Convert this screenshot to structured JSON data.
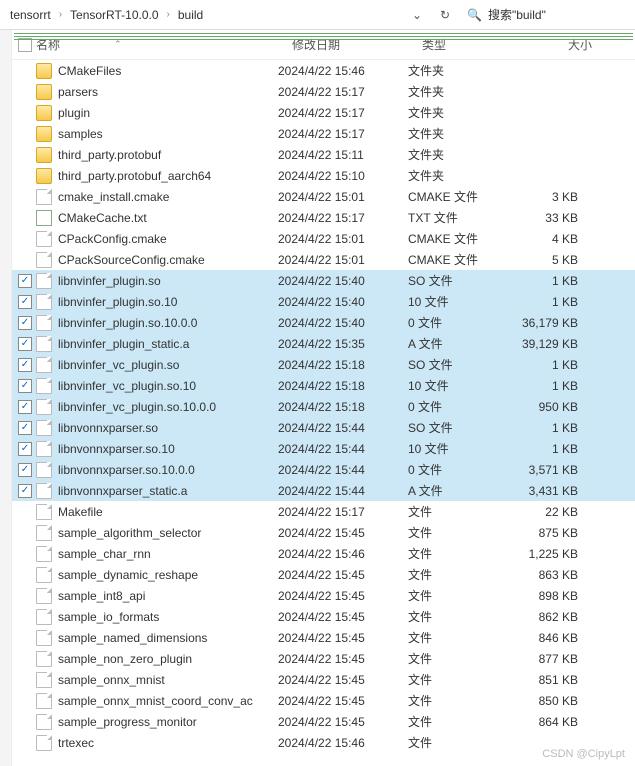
{
  "breadcrumb": {
    "a": "tensorrt",
    "b": "TensorRT-10.0.0",
    "c": "build"
  },
  "search": {
    "label": "搜索\"build\""
  },
  "columns": {
    "name": "名称",
    "date": "修改日期",
    "type": "类型",
    "size": "大小"
  },
  "rows": [
    {
      "sel": false,
      "icon": "folder",
      "name": "CMakeFiles",
      "date": "2024/4/22 15:46",
      "type": "文件夹",
      "size": ""
    },
    {
      "sel": false,
      "icon": "folder",
      "name": "parsers",
      "date": "2024/4/22 15:17",
      "type": "文件夹",
      "size": ""
    },
    {
      "sel": false,
      "icon": "folder",
      "name": "plugin",
      "date": "2024/4/22 15:17",
      "type": "文件夹",
      "size": ""
    },
    {
      "sel": false,
      "icon": "folder",
      "name": "samples",
      "date": "2024/4/22 15:17",
      "type": "文件夹",
      "size": ""
    },
    {
      "sel": false,
      "icon": "folder",
      "name": "third_party.protobuf",
      "date": "2024/4/22 15:11",
      "type": "文件夹",
      "size": ""
    },
    {
      "sel": false,
      "icon": "folder",
      "name": "third_party.protobuf_aarch64",
      "date": "2024/4/22 15:10",
      "type": "文件夹",
      "size": ""
    },
    {
      "sel": false,
      "icon": "file",
      "name": "cmake_install.cmake",
      "date": "2024/4/22 15:01",
      "type": "CMAKE 文件",
      "size": "3 KB"
    },
    {
      "sel": false,
      "icon": "txt",
      "name": "CMakeCache.txt",
      "date": "2024/4/22 15:17",
      "type": "TXT 文件",
      "size": "33 KB"
    },
    {
      "sel": false,
      "icon": "file",
      "name": "CPackConfig.cmake",
      "date": "2024/4/22 15:01",
      "type": "CMAKE 文件",
      "size": "4 KB"
    },
    {
      "sel": false,
      "icon": "file",
      "name": "CPackSourceConfig.cmake",
      "date": "2024/4/22 15:01",
      "type": "CMAKE 文件",
      "size": "5 KB"
    },
    {
      "sel": true,
      "icon": "file",
      "name": "libnvinfer_plugin.so",
      "date": "2024/4/22 15:40",
      "type": "SO 文件",
      "size": "1 KB"
    },
    {
      "sel": true,
      "icon": "file",
      "name": "libnvinfer_plugin.so.10",
      "date": "2024/4/22 15:40",
      "type": "10 文件",
      "size": "1 KB"
    },
    {
      "sel": true,
      "icon": "file",
      "name": "libnvinfer_plugin.so.10.0.0",
      "date": "2024/4/22 15:40",
      "type": "0 文件",
      "size": "36,179 KB"
    },
    {
      "sel": true,
      "icon": "file",
      "name": "libnvinfer_plugin_static.a",
      "date": "2024/4/22 15:35",
      "type": "A 文件",
      "size": "39,129 KB"
    },
    {
      "sel": true,
      "icon": "file",
      "name": "libnvinfer_vc_plugin.so",
      "date": "2024/4/22 15:18",
      "type": "SO 文件",
      "size": "1 KB"
    },
    {
      "sel": true,
      "icon": "file",
      "name": "libnvinfer_vc_plugin.so.10",
      "date": "2024/4/22 15:18",
      "type": "10 文件",
      "size": "1 KB"
    },
    {
      "sel": true,
      "icon": "file",
      "name": "libnvinfer_vc_plugin.so.10.0.0",
      "date": "2024/4/22 15:18",
      "type": "0 文件",
      "size": "950 KB"
    },
    {
      "sel": true,
      "icon": "file",
      "name": "libnvonnxparser.so",
      "date": "2024/4/22 15:44",
      "type": "SO 文件",
      "size": "1 KB"
    },
    {
      "sel": true,
      "icon": "file",
      "name": "libnvonnxparser.so.10",
      "date": "2024/4/22 15:44",
      "type": "10 文件",
      "size": "1 KB"
    },
    {
      "sel": true,
      "icon": "file",
      "name": "libnvonnxparser.so.10.0.0",
      "date": "2024/4/22 15:44",
      "type": "0 文件",
      "size": "3,571 KB"
    },
    {
      "sel": true,
      "icon": "file",
      "name": "libnvonnxparser_static.a",
      "date": "2024/4/22 15:44",
      "type": "A 文件",
      "size": "3,431 KB"
    },
    {
      "sel": false,
      "icon": "file",
      "name": "Makefile",
      "date": "2024/4/22 15:17",
      "type": "文件",
      "size": "22 KB"
    },
    {
      "sel": false,
      "icon": "file",
      "name": "sample_algorithm_selector",
      "date": "2024/4/22 15:45",
      "type": "文件",
      "size": "875 KB"
    },
    {
      "sel": false,
      "icon": "file",
      "name": "sample_char_rnn",
      "date": "2024/4/22 15:46",
      "type": "文件",
      "size": "1,225 KB"
    },
    {
      "sel": false,
      "icon": "file",
      "name": "sample_dynamic_reshape",
      "date": "2024/4/22 15:45",
      "type": "文件",
      "size": "863 KB"
    },
    {
      "sel": false,
      "icon": "file",
      "name": "sample_int8_api",
      "date": "2024/4/22 15:45",
      "type": "文件",
      "size": "898 KB"
    },
    {
      "sel": false,
      "icon": "file",
      "name": "sample_io_formats",
      "date": "2024/4/22 15:45",
      "type": "文件",
      "size": "862 KB"
    },
    {
      "sel": false,
      "icon": "file",
      "name": "sample_named_dimensions",
      "date": "2024/4/22 15:45",
      "type": "文件",
      "size": "846 KB"
    },
    {
      "sel": false,
      "icon": "file",
      "name": "sample_non_zero_plugin",
      "date": "2024/4/22 15:45",
      "type": "文件",
      "size": "877 KB"
    },
    {
      "sel": false,
      "icon": "file",
      "name": "sample_onnx_mnist",
      "date": "2024/4/22 15:45",
      "type": "文件",
      "size": "851 KB"
    },
    {
      "sel": false,
      "icon": "file",
      "name": "sample_onnx_mnist_coord_conv_ac",
      "date": "2024/4/22 15:45",
      "type": "文件",
      "size": "850 KB"
    },
    {
      "sel": false,
      "icon": "file",
      "name": "sample_progress_monitor",
      "date": "2024/4/22 15:45",
      "type": "文件",
      "size": "864 KB"
    },
    {
      "sel": false,
      "icon": "file",
      "name": "trtexec",
      "date": "2024/4/22 15:46",
      "type": "文件",
      "size": ""
    }
  ],
  "watermark": "CSDN @CipyLpt"
}
